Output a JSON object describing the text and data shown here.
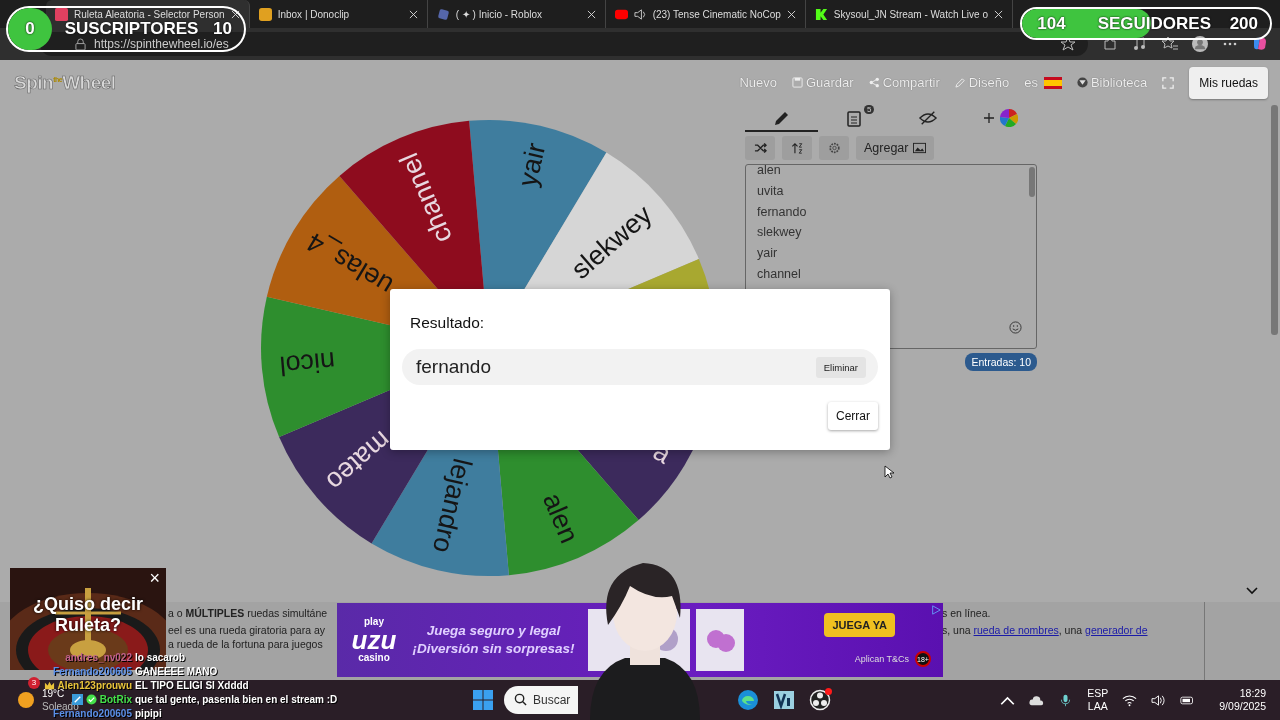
{
  "stream_overlay": {
    "subscribers": {
      "count": "0",
      "label": "SUSCRIPTORES",
      "goal": "10",
      "level": 0
    },
    "followers": {
      "count": "104",
      "label": "SEGUIDORES",
      "goal": "200",
      "level": 0.52
    }
  },
  "browser": {
    "tabs": [
      {
        "title": "Ruleta Aleatoria - Selector Person",
        "selected": true,
        "kind": "wheel",
        "audio": false
      },
      {
        "title": "Inbox | Donoclip",
        "selected": false,
        "kind": "inbox",
        "audio": false
      },
      {
        "title": "( ✦ ) Inicio - Roblox",
        "selected": false,
        "kind": "game",
        "audio": false
      },
      {
        "title": "(23) Tense Cinematic NoCop",
        "selected": false,
        "kind": "video",
        "audio": true
      },
      {
        "title": "Skysoul_JN Stream - Watch Live o",
        "selected": false,
        "kind": "stream",
        "audio": false
      }
    ],
    "address": "https://spinthewheel.io/es"
  },
  "site": {
    "logo": "Spin$^{the}$Wheel",
    "nav": [
      {
        "label": "Nuevo",
        "kind": "plain"
      },
      {
        "label": "Guardar",
        "kind": "save"
      },
      {
        "label": "Compartir",
        "kind": "share"
      },
      {
        "label": "Diseño",
        "kind": "design"
      },
      {
        "label": "es",
        "kind": "language"
      },
      {
        "label": "Biblioteca",
        "kind": "library"
      },
      {
        "kind": "fullscreen"
      }
    ],
    "account_button": "Mis ruedas"
  },
  "wheel": {
    "slices": [
      {
        "label": "yair",
        "color": "#3f7d9e"
      },
      {
        "label": "slekwey",
        "color": "#d6d6d6"
      },
      {
        "color": "#a8a830"
      },
      {
        "label": "a",
        "color": "#3c2a5c"
      },
      {
        "label": "alen",
        "color": "#2e8e2e"
      },
      {
        "label": "lejandro",
        "color": "#3f7d9e"
      },
      {
        "label": "mateo",
        "color": "#3c2a5c"
      },
      {
        "label": "nicol",
        "color": "#2e8e2e"
      },
      {
        "label": "uelas_4",
        "color": "#b05e10"
      },
      {
        "label": "channel",
        "color": "#8e0c1e"
      }
    ]
  },
  "panel": {
    "tabs": [
      {
        "kind": "edit",
        "selected": true
      },
      {
        "kind": "results",
        "selected": false,
        "badge": "5"
      },
      {
        "kind": "hide",
        "selected": false
      },
      {
        "kind": "theme",
        "selected": false
      }
    ],
    "tools": [
      {
        "kind": "shuffle"
      },
      {
        "kind": "sort"
      },
      {
        "kind": "settings"
      },
      {
        "kind": "add-image",
        "label": "Agregar"
      }
    ],
    "entries": [
      "alen",
      "uvita",
      "fernando",
      "slekwey",
      "yair",
      "channel"
    ],
    "count": "Entradas: 10"
  },
  "dialog": {
    "title": "Resultado:",
    "result": "fernando",
    "remove_button": "Eliminar",
    "close_button": "Cerrar"
  },
  "description": {
    "left_lines": [
      "a o **MÚLTIPLES** ruedas simultáne",
      "eel es una rueda giratoria para ay",
      "a rueda de la fortuna para juegos"
    ],
    "right_lines": [
      [
        {
          "text": "s en línea.",
          "link": false
        }
      ],
      [
        {
          "text": "s, una ",
          "link": false
        },
        {
          "text": "rueda de nombres",
          "link": true
        },
        {
          "text": ", una ",
          "link": false
        },
        {
          "text": "generador de",
          "link": true
        }
      ]
    ]
  },
  "ad": {
    "logo_top": "play",
    "logo_main": "uzu",
    "logo_bottom": "casino",
    "tagline": "Juega seguro y legal",
    "tagline_2": "¡Diversión sin sorpresas!",
    "cta": "JUEGA YA",
    "terms": "Aplican T&Cs",
    "age": "18+"
  },
  "suggestion_card": {
    "text": "¿Quiso decir Ruleta?",
    "close": "×"
  },
  "chat": [
    {
      "user": "andres_nv022",
      "color": "#c0608a",
      "message": "lo sacarob"
    },
    {
      "user": "Fernando200605",
      "color": "#5a8fe8",
      "message": "GANEEEE MANO"
    },
    {
      "user": "Alen123prouwu",
      "color": "#e8c33a",
      "message": "EL TIPO ELIGI SI Xdddd",
      "badges": [
        {
          "kind": "crown"
        }
      ]
    },
    {
      "user": "BotRix",
      "color": "#44e04a",
      "message": "que tal gente, pasenla bien en el stream :D",
      "badges": [
        {
          "kind": "bot"
        },
        {
          "kind": "verified"
        }
      ]
    },
    {
      "user": "Fernando200605",
      "color": "#5a8fe8",
      "message": "pipipi"
    }
  ],
  "taskbar": {
    "weather": {
      "badge": "3",
      "temperature": "19°C",
      "condition": "Soleado"
    },
    "search_placeholder": "Buscar",
    "apps": [
      {
        "kind": "edge",
        "notification": false
      },
      {
        "kind": "vs",
        "notification": false
      },
      {
        "kind": "obs",
        "notification": true
      }
    ],
    "language": "ESP",
    "region": "LAA",
    "time": "18:29",
    "date": "9/09/2025"
  }
}
